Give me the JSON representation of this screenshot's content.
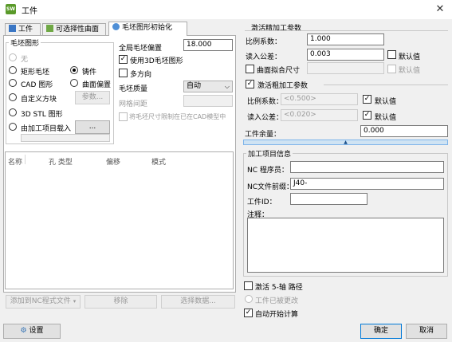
{
  "window": {
    "title": "工件",
    "app_icon": "app-icon",
    "close_icon": "close-icon"
  },
  "tabs": [
    {
      "label": "工件",
      "icon": "part-icon"
    },
    {
      "label": "可选择性曲面",
      "icon": "surface-icon"
    },
    {
      "label": "毛坯图形初始化",
      "icon": "stock-icon"
    }
  ],
  "stock_shape": {
    "group_title": "毛坯图形",
    "options": [
      {
        "label": "无",
        "checked": false,
        "disabled": true
      },
      {
        "label": "矩形毛坯",
        "checked": false
      },
      {
        "label": "铸件",
        "checked": true
      },
      {
        "label": "CAD 图形",
        "checked": false
      },
      {
        "label": "曲面偏置",
        "checked": false
      },
      {
        "label": "自定义方块",
        "checked": false
      },
      {
        "label": "3D STL 图形",
        "checked": false
      },
      {
        "label": "由加工项目载入",
        "checked": false
      }
    ],
    "params_button": "参数...",
    "ellipsis_button": "..."
  },
  "stock_settings": {
    "global_offset_label": "全局毛坯偏置",
    "global_offset_value": "18.000",
    "use_3d_label": "使用3D毛坯图形",
    "use_3d_checked": true,
    "multi_dir_label": "多方向",
    "multi_dir_checked": false,
    "stock_count_label": "毛坯质量",
    "stock_count_value": "自动",
    "grid_spacing_label": "网格间距",
    "grid_spacing_value": "",
    "limit_label": "将毛坯尺寸限制在已在CAD模型中",
    "limit_checked": false
  },
  "list": {
    "columns": [
      "名称",
      "孔 类型",
      "偏移",
      "模式"
    ]
  },
  "bottom_buttons": {
    "add_file": "添加到NC程式文件",
    "remove": "移除",
    "select_data": "选择数据..."
  },
  "settings_button": "设置",
  "finish_params": {
    "group_title": "激活精加工参数",
    "scale_label": "比例系数：",
    "scale_value": "1.000",
    "tolerance_label": "读入公差：",
    "tolerance_value": "0.003",
    "default_label": "默认值",
    "surface_label": "曲面拟合尺寸",
    "surface_default_label": "默认值"
  },
  "rough_params": {
    "activate_label": "激活粗加工参数",
    "activate_checked": true,
    "scale_label": "比例系数：",
    "scale_value": "<0.500>",
    "scale_default_label": "默认值",
    "tolerance_label": "读入公差：",
    "tolerance_value": "<0.020>",
    "tolerance_default_label": "默认值"
  },
  "stock_allowance": {
    "label": "工件余量：",
    "value": "0.000"
  },
  "job_info": {
    "group_title": "加工项目信息",
    "programmer_label": "NC 程序员：",
    "programmer_value": "",
    "prefix_label": "NC文件前缀：",
    "prefix_value": "J40-",
    "part_id_label": "工件ID：",
    "part_id_value": "",
    "notes_label": "注释："
  },
  "options": {
    "five_axis_label": "激活 5-轴 路径",
    "five_axis_checked": false,
    "part_update_label": "工件已被更改",
    "auto_calc_label": "自动开始计算",
    "auto_calc_checked": true
  },
  "dialog_buttons": {
    "ok": "确定",
    "cancel": "取消"
  },
  "colors": {
    "accent": "#0078d7",
    "window_bg": "#f0f0f0",
    "panel_bg": "#ffffff"
  }
}
